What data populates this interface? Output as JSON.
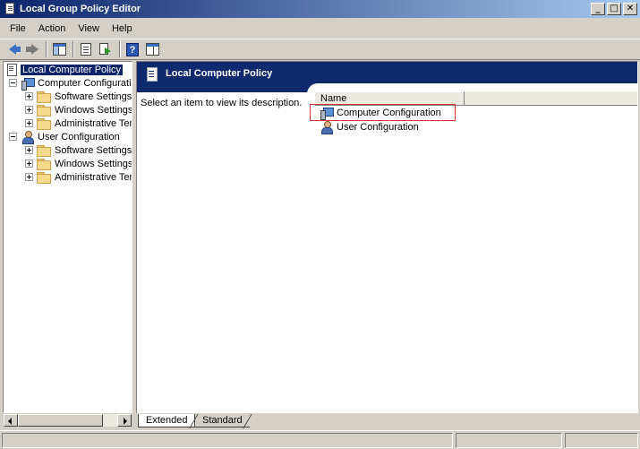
{
  "window": {
    "title": "Local Group Policy Editor",
    "min_glyph": "_",
    "max_glyph": "□",
    "close_glyph": "✕"
  },
  "menu": [
    "File",
    "Action",
    "View",
    "Help"
  ],
  "toolbar": {
    "icons": [
      "back-arrow-icon",
      "forward-arrow-icon",
      "show-hide-console-tree-icon",
      "properties-icon",
      "export-list-icon",
      "help-icon",
      "show-hide-action-pane-icon"
    ],
    "help_glyph": "?"
  },
  "tree": {
    "root": "Local Computer Policy",
    "computer": {
      "label": "Computer Configuratio",
      "children": [
        "Software Settings",
        "Windows Settings",
        "Administrative Tem"
      ]
    },
    "user": {
      "label": "User Configuration",
      "children": [
        "Software Settings",
        "Windows Settings",
        "Administrative Tem"
      ]
    }
  },
  "details": {
    "header_title": "Local Computer Policy",
    "description": "Select an item to view its description.",
    "column_name": "Name",
    "items": [
      "Computer Configuration",
      "User Configuration"
    ]
  },
  "tabs": [
    "Extended",
    "Standard"
  ],
  "colors": {
    "titlebar_start": "#0a246a",
    "banner": "#0d2a6e",
    "focus_box": "#d9342b"
  }
}
